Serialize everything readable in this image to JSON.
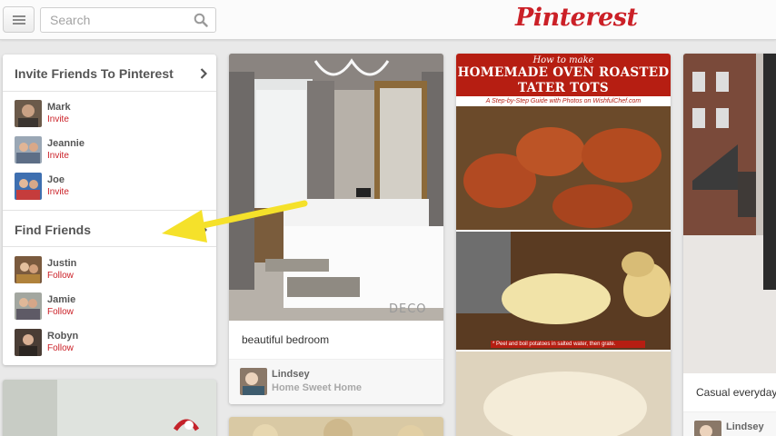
{
  "header": {
    "search_placeholder": "Search",
    "logo": "Pinterest",
    "icons": {
      "menu": "hamburger-menu-icon",
      "search": "search-icon"
    }
  },
  "sidebar": {
    "invite_title": "Invite Friends To Pinterest",
    "invite_people": [
      {
        "name": "Mark",
        "action": "Invite"
      },
      {
        "name": "Jeannie",
        "action": "Invite"
      },
      {
        "name": "Joe",
        "action": "Invite"
      }
    ],
    "find_title": "Find Friends",
    "find_people": [
      {
        "name": "Justin",
        "action": "Follow"
      },
      {
        "name": "Jamie",
        "action": "Follow"
      },
      {
        "name": "Robyn",
        "action": "Follow"
      }
    ]
  },
  "pins": [
    {
      "description": "beautiful bedroom",
      "user": "Lindsey",
      "board": "Home Sweet Home"
    },
    {
      "title_small": "How to make",
      "title_line1": "HOMEMADE OVEN ROASTED",
      "title_line2": "TATER TOTS",
      "subtitle": "A Step-by-Step Guide with Photos on WishfulChef.com",
      "caption": "* Peel and boil potatoes in salted water, then grate."
    },
    {
      "description": "Casual everyday",
      "user": "Lindsey"
    }
  ],
  "watermark": "DECO",
  "colors": {
    "brand_red": "#cb2027",
    "annotation_arrow": "#f5e12a"
  }
}
